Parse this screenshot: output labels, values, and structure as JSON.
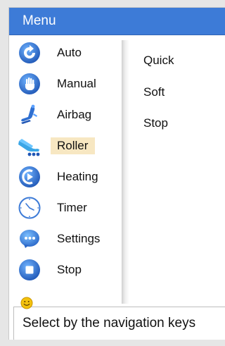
{
  "window": {
    "title": "Menu"
  },
  "menu": {
    "items": [
      {
        "label": "Auto",
        "icon": "auto-icon"
      },
      {
        "label": "Manual",
        "icon": "hand-icon"
      },
      {
        "label": "Airbag",
        "icon": "airbag-chair-icon"
      },
      {
        "label": "Roller",
        "icon": "roller-chair-icon",
        "selected": true
      },
      {
        "label": "Heating",
        "icon": "heating-icon"
      },
      {
        "label": "Timer",
        "icon": "clock-icon"
      },
      {
        "label": "Settings",
        "icon": "settings-icon"
      },
      {
        "label": "Stop",
        "icon": "stop-icon"
      }
    ]
  },
  "submenu": {
    "items": [
      {
        "label": "Quick"
      },
      {
        "label": "Soft"
      },
      {
        "label": "Stop"
      }
    ]
  },
  "status": {
    "text": "Select by the navigation keys",
    "icon": "smiley-icon"
  },
  "colors": {
    "titlebar": "#3d7bd7",
    "icon_blue": "#2f6fd0",
    "selected_bg": "#f7e7c2",
    "smiley_yellow": "#f4c20d"
  }
}
